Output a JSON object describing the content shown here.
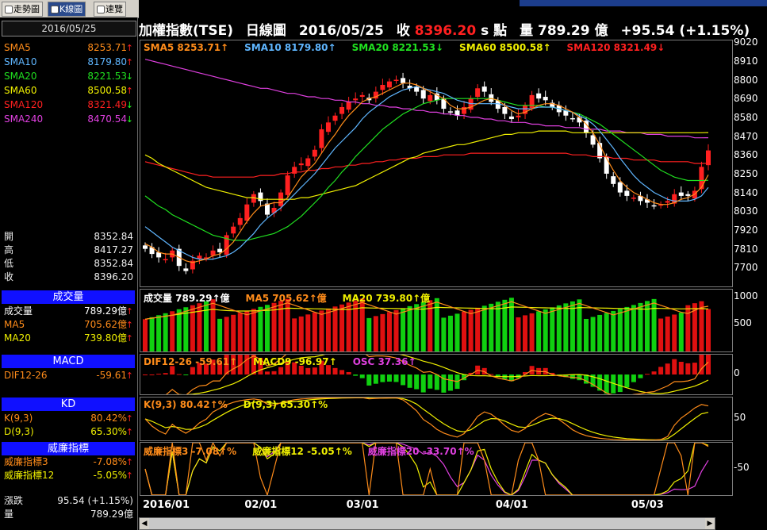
{
  "tabs": [
    {
      "label": "走勢圖",
      "active": false
    },
    {
      "label": "K線圖",
      "active": true
    },
    {
      "label": "速覽",
      "active": false
    }
  ],
  "left": {
    "date": "2016/05/25",
    "sma": [
      {
        "label": "SMA5",
        "value": "8253.71",
        "dir": "up",
        "color": "#ff8c1a"
      },
      {
        "label": "SMA10",
        "value": "8179.80",
        "dir": "up",
        "color": "#5fb6ff"
      },
      {
        "label": "SMA20",
        "value": "8221.53",
        "dir": "down",
        "color": "#20e020"
      },
      {
        "label": "SMA60",
        "value": "8500.58",
        "dir": "up",
        "color": "#f0f000"
      },
      {
        "label": "SMA120",
        "value": "8321.49",
        "dir": "down",
        "color": "#ff2020"
      },
      {
        "label": "SMA240",
        "value": "8470.54",
        "dir": "down",
        "color": "#e040e0"
      }
    ],
    "ohlc": [
      {
        "label": "開",
        "value": "8352.84"
      },
      {
        "label": "高",
        "value": "8417.27"
      },
      {
        "label": "低",
        "value": "8352.84"
      },
      {
        "label": "收",
        "value": "8396.20"
      }
    ],
    "vol_title": "成交量",
    "vol": [
      {
        "label": "成交量",
        "value": "789.29億",
        "dir": "up",
        "color": "#fff"
      },
      {
        "label": "MA5",
        "value": "705.62億",
        "dir": "up",
        "color": "#ff8c1a"
      },
      {
        "label": "MA20",
        "value": "739.80億",
        "dir": "up",
        "color": "#f0f000"
      }
    ],
    "macd_title": "MACD",
    "macd": [
      {
        "label": "DIF12-26",
        "value": "-59.61",
        "dir": "up",
        "color": "#ff8c1a"
      }
    ],
    "kd_title": "KD",
    "kd": [
      {
        "label": "K(9,3)",
        "value": "80.42%",
        "dir": "up",
        "color": "#ff8c1a"
      },
      {
        "label": "D(9,3)",
        "value": "65.30%",
        "dir": "up",
        "color": "#f0f000"
      }
    ],
    "wr_title": "威廉指標",
    "wr": [
      {
        "label": "威廉指標3",
        "value": "-7.08%",
        "dir": "up",
        "color": "#ff8c1a"
      },
      {
        "label": "威廉指標12",
        "value": "-5.05%",
        "dir": "up",
        "color": "#f0f000"
      }
    ],
    "change": {
      "label": "漲跌",
      "value": "95.54 (+1.15%)"
    },
    "volume": {
      "label": "量",
      "value": "789.29億"
    }
  },
  "header": {
    "title": "加權指數(TSE)",
    "type": "日線圖",
    "date": "2016/05/25",
    "close_label": "收",
    "close": "8396.20",
    "unit": "s 點",
    "vol_label": "量",
    "vol": "789.29 億",
    "change": "+95.54 (+1.15%)"
  },
  "price_legend": [
    {
      "text": "SMA5 8253.71↑",
      "color": "#ff8c1a"
    },
    {
      "text": "SMA10 8179.80↑",
      "color": "#5fb6ff"
    },
    {
      "text": "SMA20 8221.53↓",
      "color": "#20e020"
    },
    {
      "text": "SMA60 8500.58↑",
      "color": "#f0f000"
    },
    {
      "text": "SMA120 8321.49↓",
      "color": "#ff2020"
    }
  ],
  "vol_legend": [
    {
      "text": "成交量 789.29↑億",
      "color": "#fff"
    },
    {
      "text": "MA5 705.62↑億",
      "color": "#ff8c1a"
    },
    {
      "text": "MA20 739.80↑億",
      "color": "#f0f000"
    }
  ],
  "macd_legend": [
    {
      "text": "DIF12-26 -59.61↑",
      "color": "#ff8c1a"
    },
    {
      "text": "MACD9 -96.97↑",
      "color": "#f0f000"
    },
    {
      "text": "OSC 37.36↑",
      "color": "#e040e0"
    }
  ],
  "kd_legend": [
    {
      "text": "K(9,3) 80.42↑%",
      "color": "#ff8c1a"
    },
    {
      "text": "D(9,3) 65.30↑%",
      "color": "#f0f000"
    }
  ],
  "wr_legend": [
    {
      "text": "威廉指標3 -7.08↑%",
      "color": "#ff8c1a"
    },
    {
      "text": "威廉指標12 -5.05↑%",
      "color": "#f0f000"
    },
    {
      "text": "威廉指標20 -33.70↑%",
      "color": "#e040e0"
    }
  ],
  "chart_data": {
    "type": "candlestick",
    "y_ticks": [
      9020,
      8910,
      8800,
      8690,
      8580,
      8470,
      8360,
      8250,
      8140,
      8030,
      7920,
      7810,
      7700
    ],
    "ylim": [
      7600,
      9040
    ],
    "x_ticks": [
      {
        "label": "2016/01",
        "index": 0
      },
      {
        "label": "02/01",
        "index": 15
      },
      {
        "label": "03/01",
        "index": 30
      },
      {
        "label": "04/01",
        "index": 52
      },
      {
        "label": "05/03",
        "index": 72
      }
    ],
    "close": [
      7820,
      7790,
      7770,
      7760,
      7810,
      7720,
      7690,
      7750,
      7780,
      7770,
      7810,
      7800,
      7900,
      7950,
      8000,
      8080,
      8140,
      8100,
      8020,
      8060,
      8150,
      8250,
      8300,
      8320,
      8350,
      8400,
      8520,
      8560,
      8600,
      8650,
      8680,
      8700,
      8720,
      8690,
      8740,
      8780,
      8800,
      8810,
      8790,
      8760,
      8740,
      8700,
      8720,
      8690,
      8640,
      8620,
      8600,
      8650,
      8700,
      8760,
      8740,
      8680,
      8640,
      8610,
      8580,
      8600,
      8660,
      8720,
      8700,
      8690,
      8650,
      8620,
      8600,
      8580,
      8560,
      8500,
      8430,
      8350,
      8260,
      8200,
      8150,
      8130,
      8120,
      8100,
      8090,
      8070,
      8080,
      8100,
      8140,
      8130,
      8130,
      8160,
      8300,
      8396.2
    ],
    "sma5": [
      7850,
      7830,
      7800,
      7790,
      7790,
      7770,
      7750,
      7740,
      7750,
      7760,
      7780,
      7790,
      7820,
      7860,
      7920,
      7980,
      8030,
      8070,
      8080,
      8090,
      8090,
      8120,
      8180,
      8240,
      8280,
      8320,
      8380,
      8440,
      8490,
      8550,
      8600,
      8640,
      8680,
      8700,
      8710,
      8730,
      8750,
      8770,
      8790,
      8790,
      8780,
      8760,
      8740,
      8720,
      8700,
      8660,
      8640,
      8640,
      8650,
      8670,
      8690,
      8700,
      8690,
      8660,
      8630,
      8610,
      8620,
      8640,
      8660,
      8670,
      8670,
      8660,
      8640,
      8620,
      8590,
      8550,
      8500,
      8430,
      8350,
      8280,
      8220,
      8180,
      8150,
      8130,
      8110,
      8090,
      8080,
      8080,
      8090,
      8110,
      8120,
      8140,
      8180,
      8253.71
    ],
    "sma10": [
      7950,
      7920,
      7890,
      7860,
      7830,
      7810,
      7790,
      7770,
      7760,
      7760,
      7760,
      7770,
      7780,
      7800,
      7830,
      7870,
      7910,
      7960,
      8000,
      8030,
      8060,
      8100,
      8140,
      8180,
      8220,
      8260,
      8310,
      8360,
      8410,
      8450,
      8490,
      8530,
      8580,
      8620,
      8650,
      8680,
      8710,
      8730,
      8750,
      8760,
      8770,
      8760,
      8750,
      8740,
      8730,
      8710,
      8690,
      8680,
      8670,
      8670,
      8670,
      8670,
      8670,
      8660,
      8650,
      8640,
      8640,
      8640,
      8650,
      8650,
      8650,
      8640,
      8630,
      8620,
      8600,
      8580,
      8550,
      8510,
      8460,
      8410,
      8350,
      8300,
      8250,
      8210,
      8180,
      8150,
      8130,
      8110,
      8100,
      8100,
      8100,
      8110,
      8130,
      8179.8
    ],
    "sma20": [
      8130,
      8100,
      8070,
      8050,
      8020,
      8000,
      7980,
      7960,
      7940,
      7920,
      7900,
      7890,
      7880,
      7870,
      7870,
      7870,
      7880,
      7890,
      7900,
      7910,
      7930,
      7950,
      7980,
      8010,
      8050,
      8090,
      8130,
      8180,
      8220,
      8270,
      8310,
      8360,
      8400,
      8440,
      8480,
      8520,
      8550,
      8580,
      8610,
      8630,
      8650,
      8670,
      8680,
      8690,
      8700,
      8700,
      8700,
      8700,
      8700,
      8700,
      8700,
      8700,
      8690,
      8680,
      8670,
      8660,
      8660,
      8660,
      8660,
      8650,
      8650,
      8640,
      8630,
      8620,
      8610,
      8590,
      8570,
      8550,
      8520,
      8490,
      8460,
      8430,
      8400,
      8370,
      8340,
      8310,
      8280,
      8260,
      8240,
      8230,
      8220,
      8220,
      8220,
      8221.53
    ],
    "sma60": [
      8370,
      8350,
      8320,
      8300,
      8280,
      8260,
      8240,
      8220,
      8200,
      8180,
      8170,
      8160,
      8150,
      8140,
      8130,
      8120,
      8120,
      8110,
      8110,
      8110,
      8110,
      8110,
      8110,
      8120,
      8120,
      8130,
      8140,
      8150,
      8160,
      8170,
      8180,
      8190,
      8210,
      8230,
      8250,
      8270,
      8290,
      8310,
      8330,
      8350,
      8360,
      8380,
      8390,
      8400,
      8410,
      8420,
      8430,
      8430,
      8440,
      8450,
      8460,
      8470,
      8480,
      8490,
      8490,
      8500,
      8500,
      8500,
      8510,
      8510,
      8510,
      8510,
      8510,
      8500,
      8500,
      8500,
      8500,
      8500,
      8500,
      8500,
      8500,
      8500,
      8500,
      8500,
      8500,
      8500,
      8500,
      8500,
      8500,
      8500,
      8500,
      8500,
      8500,
      8500.58
    ],
    "sma120": [
      8330,
      8320,
      8310,
      8300,
      8290,
      8280,
      8270,
      8260,
      8250,
      8250,
      8240,
      8240,
      8240,
      8240,
      8240,
      8240,
      8240,
      8250,
      8250,
      8250,
      8260,
      8260,
      8270,
      8270,
      8280,
      8280,
      8290,
      8290,
      8300,
      8300,
      8310,
      8310,
      8320,
      8320,
      8330,
      8330,
      8340,
      8340,
      8350,
      8350,
      8350,
      8360,
      8360,
      8360,
      8370,
      8370,
      8370,
      8370,
      8380,
      8380,
      8380,
      8380,
      8380,
      8380,
      8380,
      8380,
      8380,
      8380,
      8380,
      8380,
      8380,
      8380,
      8380,
      8370,
      8370,
      8370,
      8360,
      8360,
      8360,
      8350,
      8350,
      8350,
      8340,
      8340,
      8340,
      8340,
      8330,
      8330,
      8330,
      8330,
      8330,
      8320,
      8320,
      8321.49
    ],
    "sma240": [
      8930,
      8920,
      8910,
      8900,
      8890,
      8880,
      8870,
      8860,
      8850,
      8840,
      8830,
      8820,
      8810,
      8800,
      8790,
      8780,
      8770,
      8760,
      8760,
      8750,
      8740,
      8730,
      8730,
      8720,
      8710,
      8710,
      8700,
      8700,
      8690,
      8690,
      8680,
      8680,
      8670,
      8670,
      8660,
      8660,
      8650,
      8650,
      8640,
      8640,
      8630,
      8630,
      8620,
      8620,
      8610,
      8610,
      8600,
      8600,
      8590,
      8590,
      8580,
      8580,
      8570,
      8570,
      8560,
      8560,
      8560,
      8550,
      8550,
      8540,
      8540,
      8540,
      8530,
      8530,
      8530,
      8520,
      8520,
      8520,
      8510,
      8510,
      8510,
      8500,
      8500,
      8500,
      8490,
      8490,
      8490,
      8480,
      8480,
      8480,
      8480,
      8470,
      8470,
      8470.54
    ],
    "volume_ticks": [
      1000,
      500
    ],
    "volume_ylim": [
      0,
      1150
    ],
    "macd_ticks": [
      0
    ],
    "kd_ticks": [
      50
    ],
    "wr_ticks": [
      -50
    ]
  }
}
